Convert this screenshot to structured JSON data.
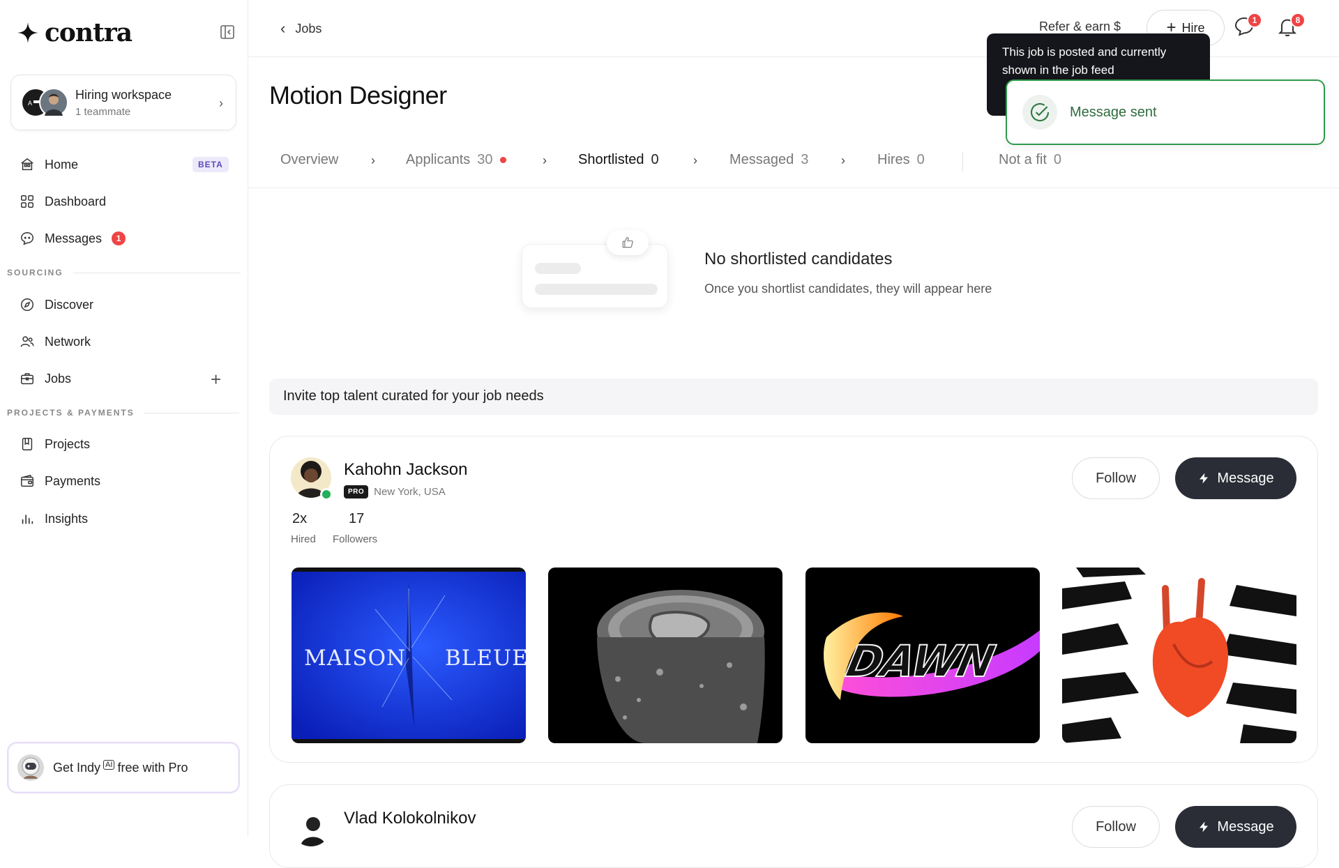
{
  "app": {
    "logo_text": "contra"
  },
  "sidebar": {
    "workspace": {
      "title": "Hiring workspace",
      "subtitle": "1 teammate"
    },
    "nav": [
      {
        "label": "Home",
        "badge": "BETA"
      },
      {
        "label": "Dashboard"
      },
      {
        "label": "Messages",
        "badge": "1"
      },
      {
        "label": "Discover"
      },
      {
        "label": "Network"
      },
      {
        "label": "Jobs"
      },
      {
        "label": "Projects"
      },
      {
        "label": "Payments"
      },
      {
        "label": "Insights"
      }
    ],
    "sections": {
      "sourcing": "SOURCING",
      "projects": "PROJECTS & PAYMENTS"
    },
    "promo": {
      "prefix": "Get Indy",
      "ai": "AI",
      "suffix": "free with Pro"
    }
  },
  "topbar": {
    "back_label": "Jobs",
    "refer_label": "Refer & earn $",
    "hire_label": "Hire",
    "messages_badge": "1",
    "notifications_badge": "8"
  },
  "page": {
    "title": "Motion Designer"
  },
  "tabs": [
    {
      "label": "Overview",
      "count": ""
    },
    {
      "label": "Applicants",
      "count": "30"
    },
    {
      "label": "Shortlisted",
      "count": "0"
    },
    {
      "label": "Messaged",
      "count": "3"
    },
    {
      "label": "Hires",
      "count": "0"
    },
    {
      "label": "Not a fit",
      "count": "0"
    }
  ],
  "empty_state": {
    "title": "No shortlisted candidates",
    "subtitle": "Once you shortlist candidates, they will appear here"
  },
  "invite": {
    "text": "Invite top talent curated for your job needs"
  },
  "candidates": [
    {
      "name": "Kahohn Jackson",
      "pro": "PRO",
      "location": "New York, USA",
      "hired_value": "2x",
      "hired_label": "Hired",
      "followers_value": "17",
      "followers_label": "Followers",
      "follow_label": "Follow",
      "message_label": "Message",
      "portfolio": [
        {
          "left": "MAISON",
          "right": "BLEUE"
        },
        {
          "caption": ""
        },
        {
          "caption": "DAWN"
        },
        {
          "caption": ""
        }
      ]
    },
    {
      "name": "Vlad Kolokolnikov",
      "follow_label": "Follow",
      "message_label": "Message"
    }
  ],
  "tooltip": {
    "text": "This job is posted and currently shown in the job feed"
  },
  "toast": {
    "text": "Message sent"
  },
  "colors": {
    "accent_dark": "#2a2d36",
    "success": "#2f9a4a",
    "alert": "#ef4444"
  }
}
